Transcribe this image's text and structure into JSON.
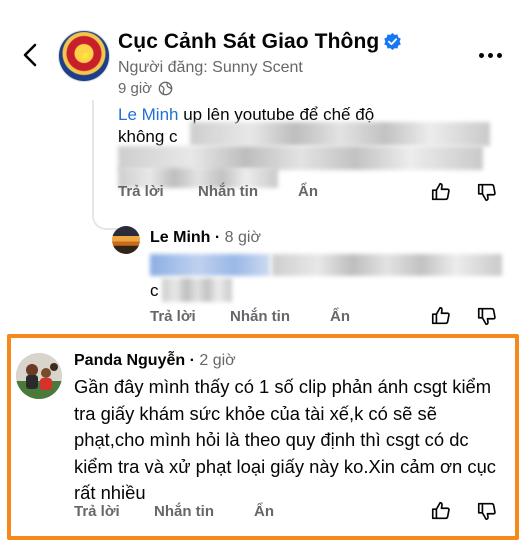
{
  "header": {
    "title": "Cục Cảnh Sát Giao Thông",
    "poster": "Người đăng: Sunny Scent",
    "time": "9 giờ"
  },
  "comment1": {
    "mention": "Le Minh",
    "text": " up lên youtube để chế độ",
    "text2": "không c",
    "actions": {
      "reply": "Trả lời",
      "message": "Nhắn tin",
      "hide": "Ẩn"
    }
  },
  "comment2": {
    "author": "Le Minh",
    "time": "8 giờ",
    "text_prefix": "c",
    "actions": {
      "reply": "Trả lời",
      "message": "Nhắn tin",
      "hide": "Ẩn"
    }
  },
  "comment3": {
    "author": "Panda Nguyễn",
    "time": "2 giờ",
    "text": "Gần đây mình thấy có 1 số clip phản ánh csgt kiểm tra giấy khám sức khỏe của tài xế,k có sẽ sẽ phạt,cho mình hỏi là theo quy định thì csgt có dc kiểm tra và xử phạt loại giấy này ko.Xin cảm ơn cục rất nhiều",
    "actions": {
      "reply": "Trả lời",
      "message": "Nhắn tin",
      "hide": "Ẩn"
    }
  },
  "icons": {
    "back": "chevron-left-icon",
    "verified": "verified-badge-icon",
    "audience": "globe-icon",
    "more": "more-dots-icon",
    "like": "thumbs-up-icon",
    "dislike": "thumbs-down-icon"
  },
  "colors": {
    "highlight_border": "#f58a1a",
    "verified": "#1877f2",
    "mention": "#216fdb",
    "secondary_text": "#65676b"
  }
}
